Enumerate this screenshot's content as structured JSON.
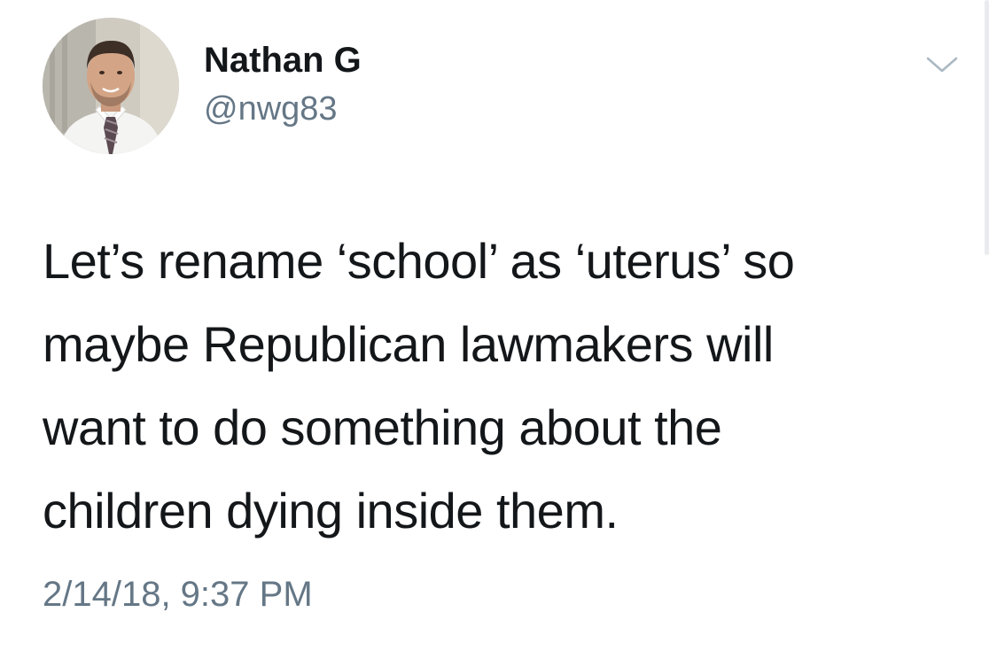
{
  "author": {
    "display_name": "Nathan G",
    "handle": "@nwg83"
  },
  "tweet": {
    "text_lines": [
      "Let’s rename ‘school’ as ‘uterus’ so",
      "maybe Republican lawmakers will",
      "want to do something about the",
      "children dying inside them."
    ],
    "timestamp": "2/14/18, 9:37 PM"
  },
  "icons": {
    "menu": "chevron-down-icon",
    "avatar": "profile-photo"
  },
  "colors": {
    "text_primary": "#14171a",
    "text_secondary": "#657786",
    "background": "#ffffff"
  }
}
